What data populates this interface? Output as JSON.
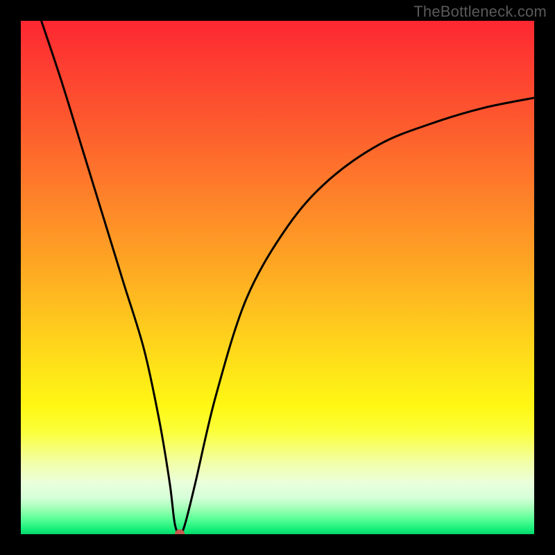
{
  "watermark": "TheBottleneck.com",
  "chart_data": {
    "type": "line",
    "title": "",
    "xlabel": "",
    "ylabel": "",
    "xlim": [
      0,
      100
    ],
    "ylim": [
      0,
      100
    ],
    "grid": false,
    "legend": false,
    "series": [
      {
        "name": "bottleneck-curve",
        "x": [
          4,
          8,
          12,
          16,
          20,
          24,
          27,
          29,
          30,
          31,
          32,
          34,
          38,
          44,
          52,
          60,
          70,
          80,
          90,
          100
        ],
        "y": [
          100,
          88,
          75,
          62,
          49,
          36,
          22,
          10,
          2,
          0,
          2,
          10,
          27,
          46,
          60,
          69,
          76,
          80,
          83,
          85
        ]
      }
    ],
    "annotations": [
      {
        "name": "minimum-marker",
        "x": 31,
        "y": 0,
        "color": "#c65a4e"
      }
    ],
    "background_gradient": {
      "orientation": "vertical",
      "stops": [
        {
          "pos": 0.0,
          "color": "#fd2731"
        },
        {
          "pos": 0.33,
          "color": "#fe7e2a"
        },
        {
          "pos": 0.66,
          "color": "#fee418"
        },
        {
          "pos": 0.9,
          "color": "#eaffdc"
        },
        {
          "pos": 1.0,
          "color": "#06d66a"
        }
      ]
    }
  }
}
